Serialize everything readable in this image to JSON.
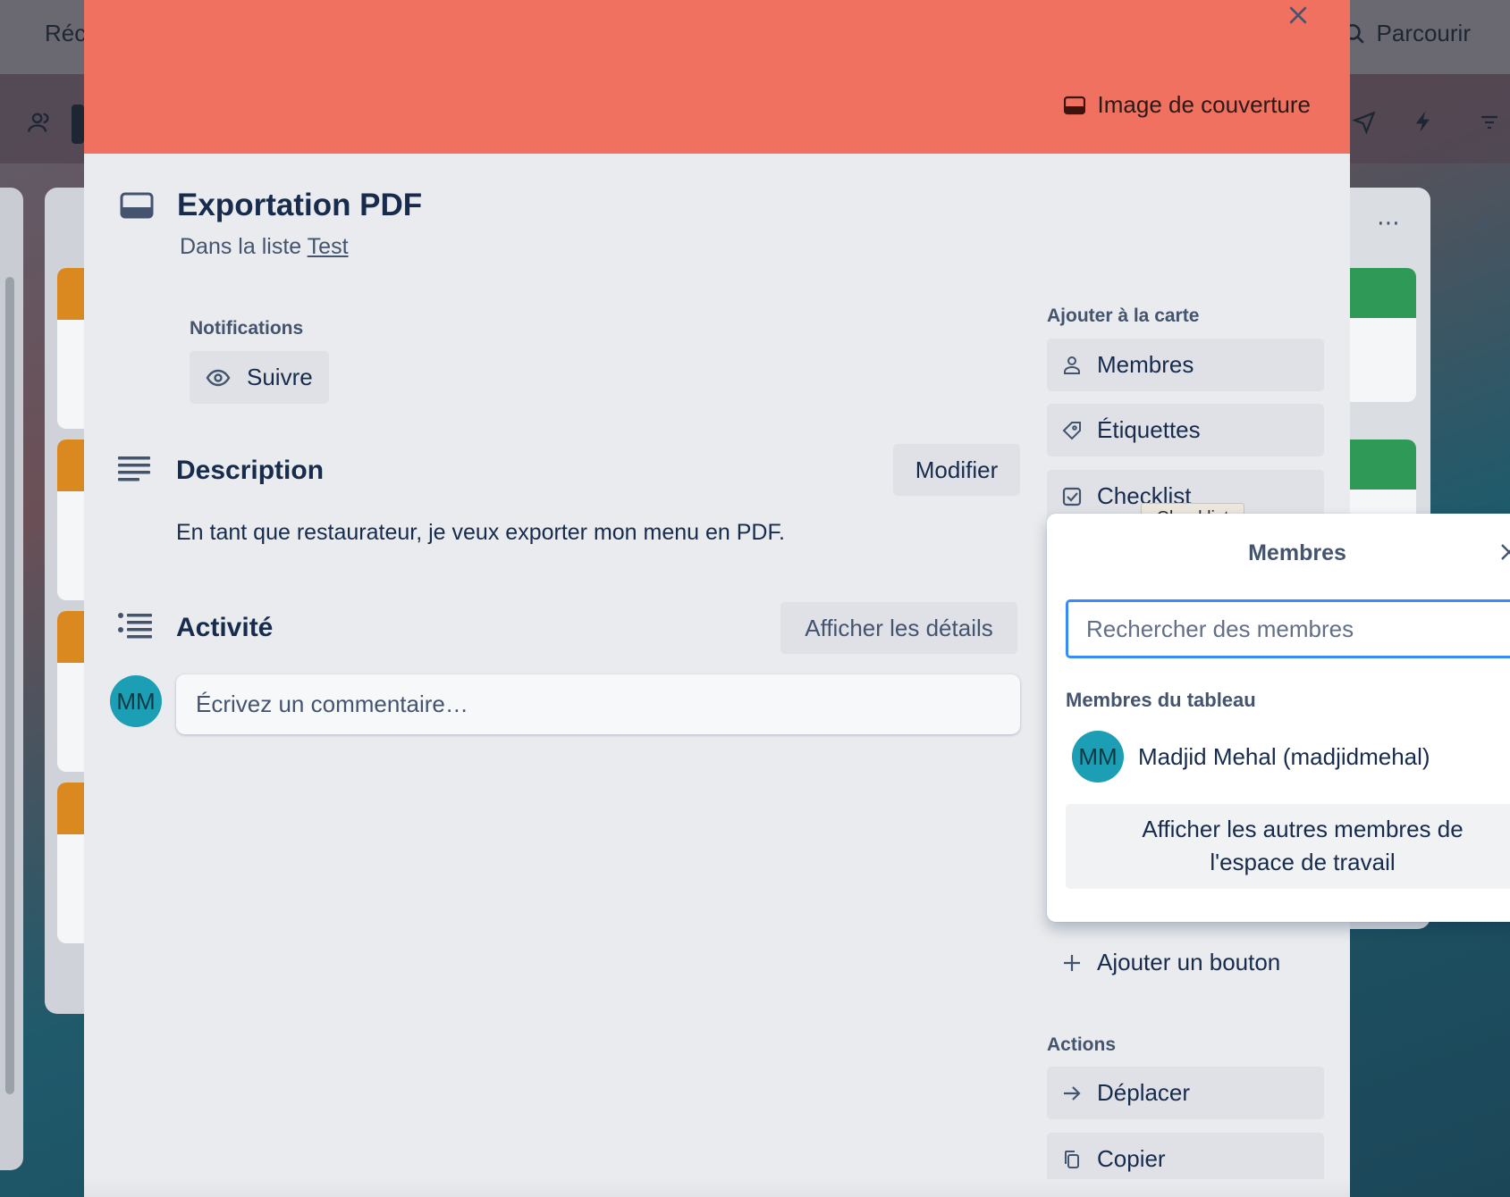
{
  "background": {
    "nav_text": "Réc",
    "browse_label": "Parcourir"
  },
  "card": {
    "cover_button": "Image de couverture",
    "title": "Exportation PDF",
    "in_list_prefix": "Dans la liste ",
    "list_name": "Test",
    "notifications_label": "Notifications",
    "follow_label": "Suivre",
    "description_title": "Description",
    "edit_label": "Modifier",
    "description_text": "En tant que restaurateur, je veux exporter mon menu en PDF.",
    "activity_title": "Activité",
    "show_details_label": "Afficher les détails",
    "comment_placeholder": "Écrivez un commentaire…",
    "user_initials": "MM"
  },
  "sidebar": {
    "add_label": "Ajouter à la carte",
    "members": "Membres",
    "labels": "Étiquettes",
    "checklist": "Checklist",
    "add_button": "Ajouter un bouton",
    "actions_label": "Actions",
    "move": "Déplacer",
    "copy": "Copier"
  },
  "tooltip": {
    "text": "Checklist"
  },
  "members_popover": {
    "title": "Membres",
    "search_placeholder": "Rechercher des membres",
    "board_members_label": "Membres du tableau",
    "member_initials": "MM",
    "member_name": "Madjid Mehal (madjidmehal)",
    "show_more_line1": "Afficher les autres membres de",
    "show_more_line2": "l'espace de travail"
  },
  "colors": {
    "cover": "#f07160",
    "avatar": "#1c9fb5",
    "focus": "#388bff"
  }
}
